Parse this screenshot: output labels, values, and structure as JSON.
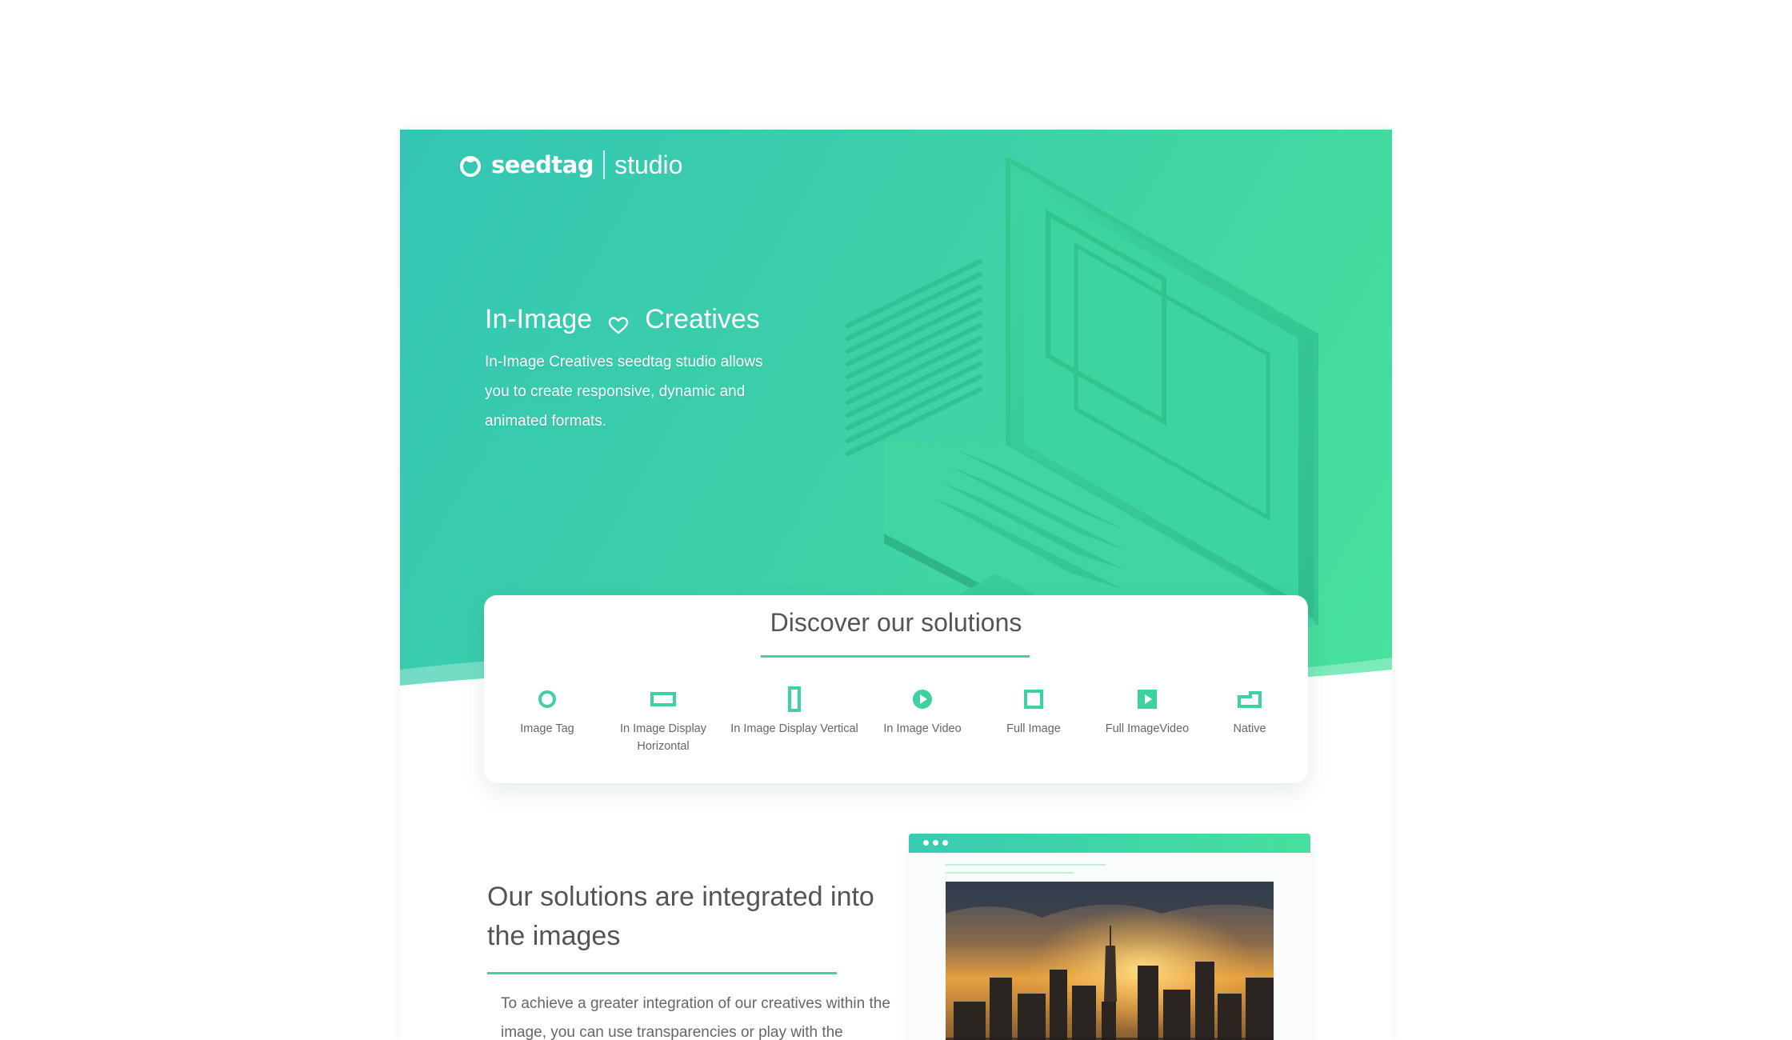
{
  "brand": {
    "name": "seedtag",
    "product": "studio"
  },
  "hero": {
    "title_part1": "In-Image",
    "title_part2": "Creatives",
    "description": "In-Image Creatives seedtag studio allows you to create responsive, dynamic and animated formats."
  },
  "solutions": {
    "title": "Discover our solutions",
    "items": [
      {
        "icon": "circle-icon",
        "label": "Image Tag"
      },
      {
        "icon": "horizontal-rectangle-icon",
        "label": "In Image Display Horizontal"
      },
      {
        "icon": "vertical-rectangle-icon",
        "label": "In Image Display Vertical"
      },
      {
        "icon": "play-circle-icon",
        "label": "In Image Video"
      },
      {
        "icon": "square-icon",
        "label": "Full Image"
      },
      {
        "icon": "play-square-icon",
        "label": "Full ImageVideo"
      },
      {
        "icon": "native-icon",
        "label": "Native"
      }
    ]
  },
  "section2": {
    "title": "Our solutions are integrated into the images",
    "text": "To achieve a greater integration of our creatives within the image, you can use transparencies or play with the"
  },
  "colors": {
    "accent": "#3dd29f",
    "hero_start": "#33c6b4",
    "hero_end": "#48e29c",
    "text": "#555555"
  }
}
